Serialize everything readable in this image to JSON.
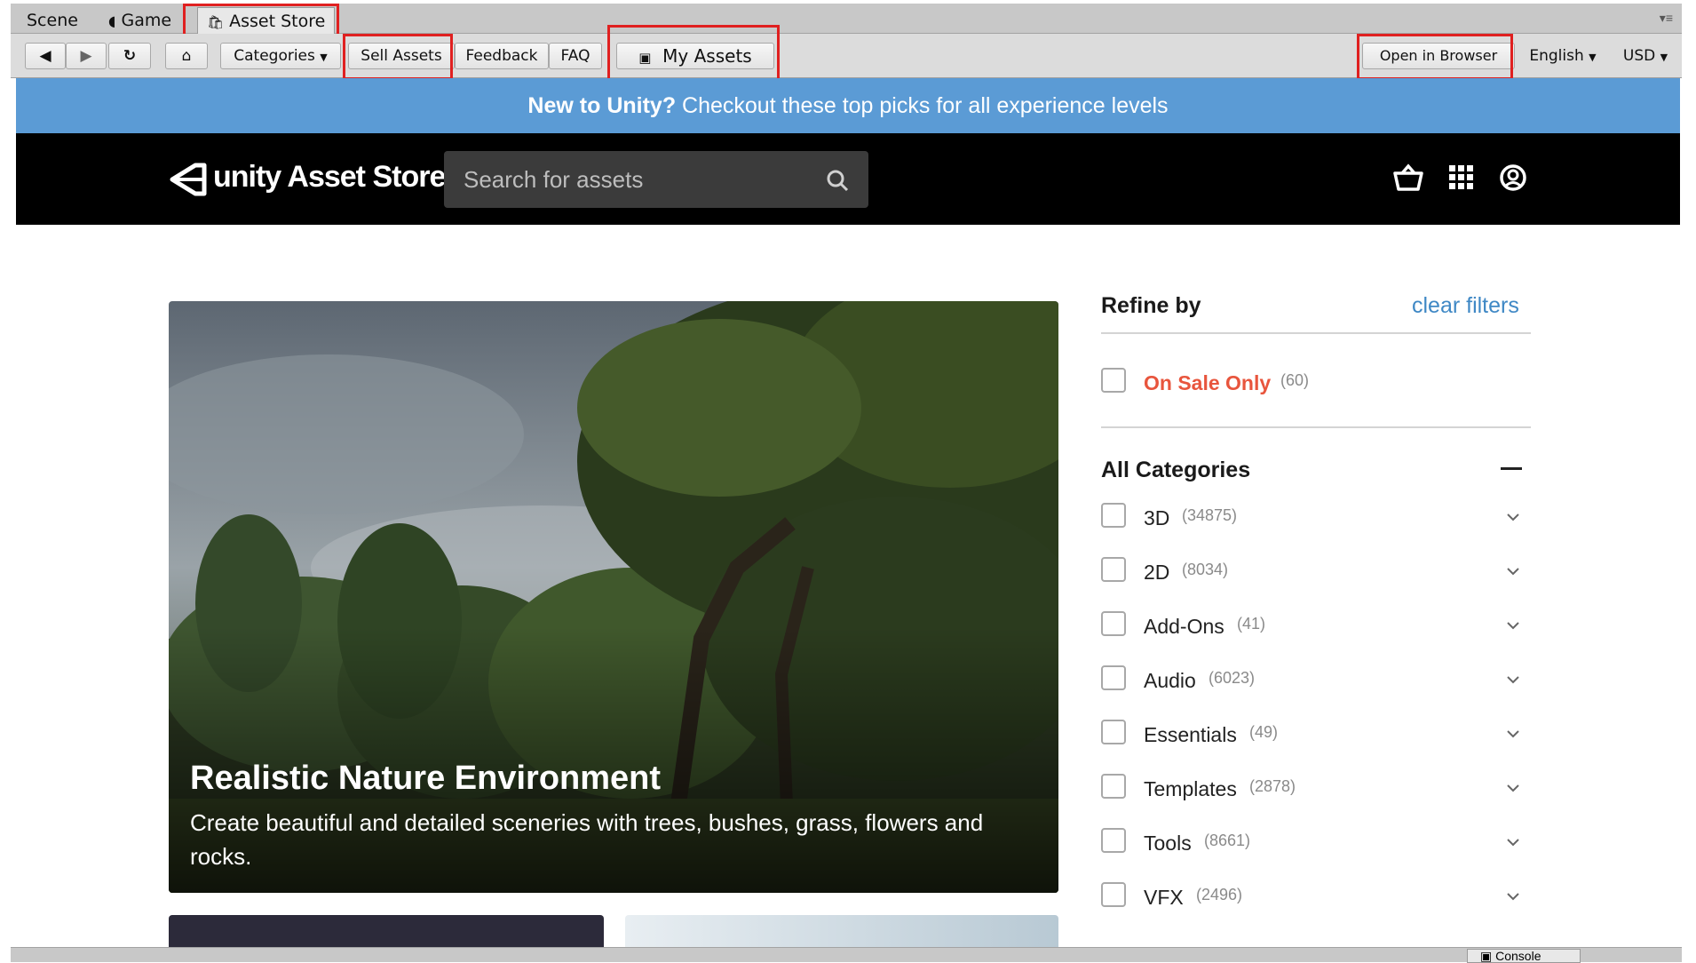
{
  "tabs": [
    {
      "label": "Scene"
    },
    {
      "label": "Game"
    },
    {
      "label": "Asset Store"
    }
  ],
  "toolbar": {
    "categories": "Categories",
    "sell_assets": "Sell Assets",
    "feedback": "Feedback",
    "faq": "FAQ",
    "my_assets": "My Assets",
    "open_in_browser": "Open in Browser",
    "language": "English",
    "currency": "USD"
  },
  "banner": {
    "bold": "New to Unity?",
    "text": " Checkout these top picks for all experience levels"
  },
  "header": {
    "logo_text": "unity Asset Store",
    "search_placeholder": "Search for assets"
  },
  "hero": {
    "title": "Realistic Nature Environment",
    "description": "Create beautiful and detailed sceneries with trees, bushes, grass, flowers and rocks."
  },
  "filters": {
    "refine_title": "Refine by",
    "clear_label": "clear filters",
    "on_sale": {
      "label": "On Sale Only",
      "count": "(60)"
    },
    "categories_title": "All Categories",
    "categories": [
      {
        "label": "3D",
        "count": "(34875)"
      },
      {
        "label": "2D",
        "count": "(8034)"
      },
      {
        "label": "Add-Ons",
        "count": "(41)"
      },
      {
        "label": "Audio",
        "count": "(6023)"
      },
      {
        "label": "Essentials",
        "count": "(49)"
      },
      {
        "label": "Templates",
        "count": "(2878)"
      },
      {
        "label": "Tools",
        "count": "(8661)"
      },
      {
        "label": "VFX",
        "count": "(2496)"
      }
    ]
  },
  "bottom": {
    "console_tab": "Console"
  },
  "colors": {
    "banner": "#5b9bd5",
    "sale_red": "#e8553d",
    "link_blue": "#3f88c5",
    "highlight_box": "#e02020"
  }
}
